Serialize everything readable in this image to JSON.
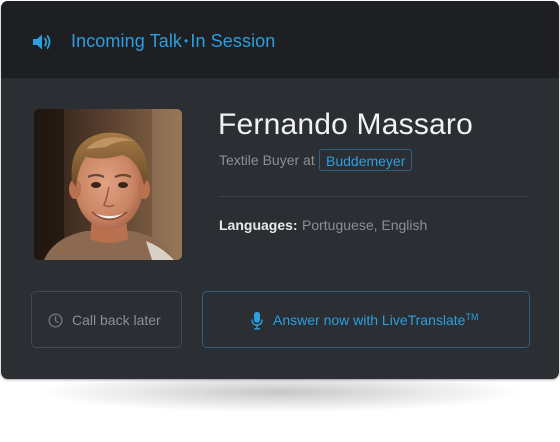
{
  "header": {
    "icon": "speaker-icon",
    "title_part1": "Incoming Talk",
    "separator": "•",
    "title_part2": "In Session"
  },
  "contact": {
    "name": "Fernando Massaro",
    "role": "Textile Buyer at",
    "company": "Buddemeyer",
    "languages_label": "Languages:",
    "languages": "Portuguese,  English"
  },
  "actions": {
    "callback_label": "Call back later",
    "callback_icon": "clock-icon",
    "answer_label": "Answer now with LiveTranslate",
    "answer_trademark": "TM",
    "answer_icon": "microphone-icon"
  },
  "colors": {
    "accent": "#2b9fe0",
    "card_background": "#2b2e32",
    "header_background": "#1d1f22"
  }
}
